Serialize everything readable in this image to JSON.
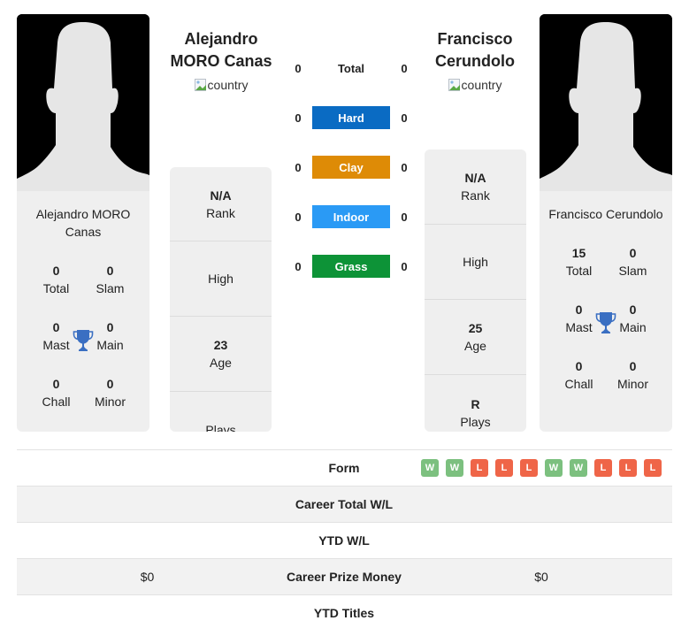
{
  "player1": {
    "name": "Alejandro MORO Canas",
    "name_line1": "Alejandro",
    "name_line2": "MORO Canas",
    "card_name": "Alejandro MORO Canas",
    "country_alt": "country",
    "titles": {
      "total": {
        "value": "0",
        "label": "Total"
      },
      "slam": {
        "value": "0",
        "label": "Slam"
      },
      "mast": {
        "value": "0",
        "label": "Mast"
      },
      "main": {
        "value": "0",
        "label": "Main"
      },
      "chall": {
        "value": "0",
        "label": "Chall"
      },
      "minor": {
        "value": "0",
        "label": "Minor"
      }
    },
    "stats": {
      "rank": {
        "value": "N/A",
        "label": "Rank"
      },
      "high": {
        "value": "",
        "label": "High"
      },
      "age": {
        "value": "23",
        "label": "Age"
      },
      "plays": {
        "value": "",
        "label": "Plays"
      }
    }
  },
  "player2": {
    "name": "Francisco Cerundolo",
    "name_line1": "Francisco",
    "name_line2": "Cerundolo",
    "card_name": "Francisco Cerundolo",
    "country_alt": "country",
    "titles": {
      "total": {
        "value": "15",
        "label": "Total"
      },
      "slam": {
        "value": "0",
        "label": "Slam"
      },
      "mast": {
        "value": "0",
        "label": "Mast"
      },
      "main": {
        "value": "0",
        "label": "Main"
      },
      "chall": {
        "value": "0",
        "label": "Chall"
      },
      "minor": {
        "value": "0",
        "label": "Minor"
      }
    },
    "stats": {
      "rank": {
        "value": "N/A",
        "label": "Rank"
      },
      "high": {
        "value": "",
        "label": "High"
      },
      "age": {
        "value": "25",
        "label": "Age"
      },
      "plays": {
        "value": "R",
        "label": "Plays"
      }
    }
  },
  "h2h": [
    {
      "label": "Total",
      "p1": "0",
      "p2": "0",
      "color": ""
    },
    {
      "label": "Hard",
      "p1": "0",
      "p2": "0",
      "color": "#0a6bc3"
    },
    {
      "label": "Clay",
      "p1": "0",
      "p2": "0",
      "color": "#de8b06"
    },
    {
      "label": "Indoor",
      "p1": "0",
      "p2": "0",
      "color": "#2a9af5"
    },
    {
      "label": "Grass",
      "p1": "0",
      "p2": "0",
      "color": "#0d9337"
    }
  ],
  "icons": {
    "trophy": "trophy-icon",
    "country_flag": "broken-image-icon"
  },
  "colors": {
    "win": "#7cc07f",
    "loss": "#ef6548",
    "trophy": "#3a6fc2"
  },
  "table": {
    "form_label": "Form",
    "form": [
      "W",
      "W",
      "L",
      "L",
      "L",
      "W",
      "W",
      "L",
      "L",
      "L"
    ],
    "rows": [
      {
        "label": "Career Total W/L",
        "p1": "",
        "p2": ""
      },
      {
        "label": "YTD W/L",
        "p1": "",
        "p2": ""
      },
      {
        "label": "Career Prize Money",
        "p1": "$0",
        "p2": "$0"
      },
      {
        "label": "YTD Titles",
        "p1": "",
        "p2": ""
      }
    ]
  }
}
